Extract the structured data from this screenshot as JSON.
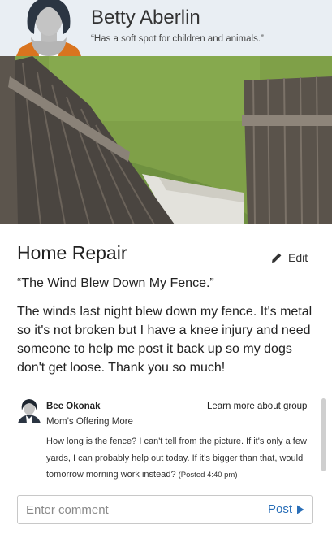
{
  "profile": {
    "name": "Betty Aberlin",
    "tagline": "“Has a soft spot for children and animals.”"
  },
  "post": {
    "title": "Home Repair",
    "edit_label": "Edit",
    "subtitle": "“The Wind Blew Down My Fence.”",
    "body": "The winds last night blew down my fence. It's metal so it's not broken but I have a knee injury and need someone to help me post it back up so my dogs don't get loose. Thank you so much!"
  },
  "comments": [
    {
      "author": "Bee Okonak",
      "role": "Mom’s Offering More",
      "learn_more": "Learn more about group",
      "text": "How long is the fence? I can't tell from the picture. If it's only a few yards, I can probably help out today. If it's bigger than that, would tomorrow morning work instead?",
      "posted": "(Posted 4:40 pm)"
    }
  ],
  "comment_input": {
    "placeholder": "Enter comment",
    "post_label": "Post"
  },
  "icons": {
    "edit": "pencil-icon",
    "post": "play-triangle-icon"
  },
  "colors": {
    "header_bg": "#e9eef3",
    "link_blue": "#2a6fb8",
    "avatar_orange": "#d9741f"
  }
}
